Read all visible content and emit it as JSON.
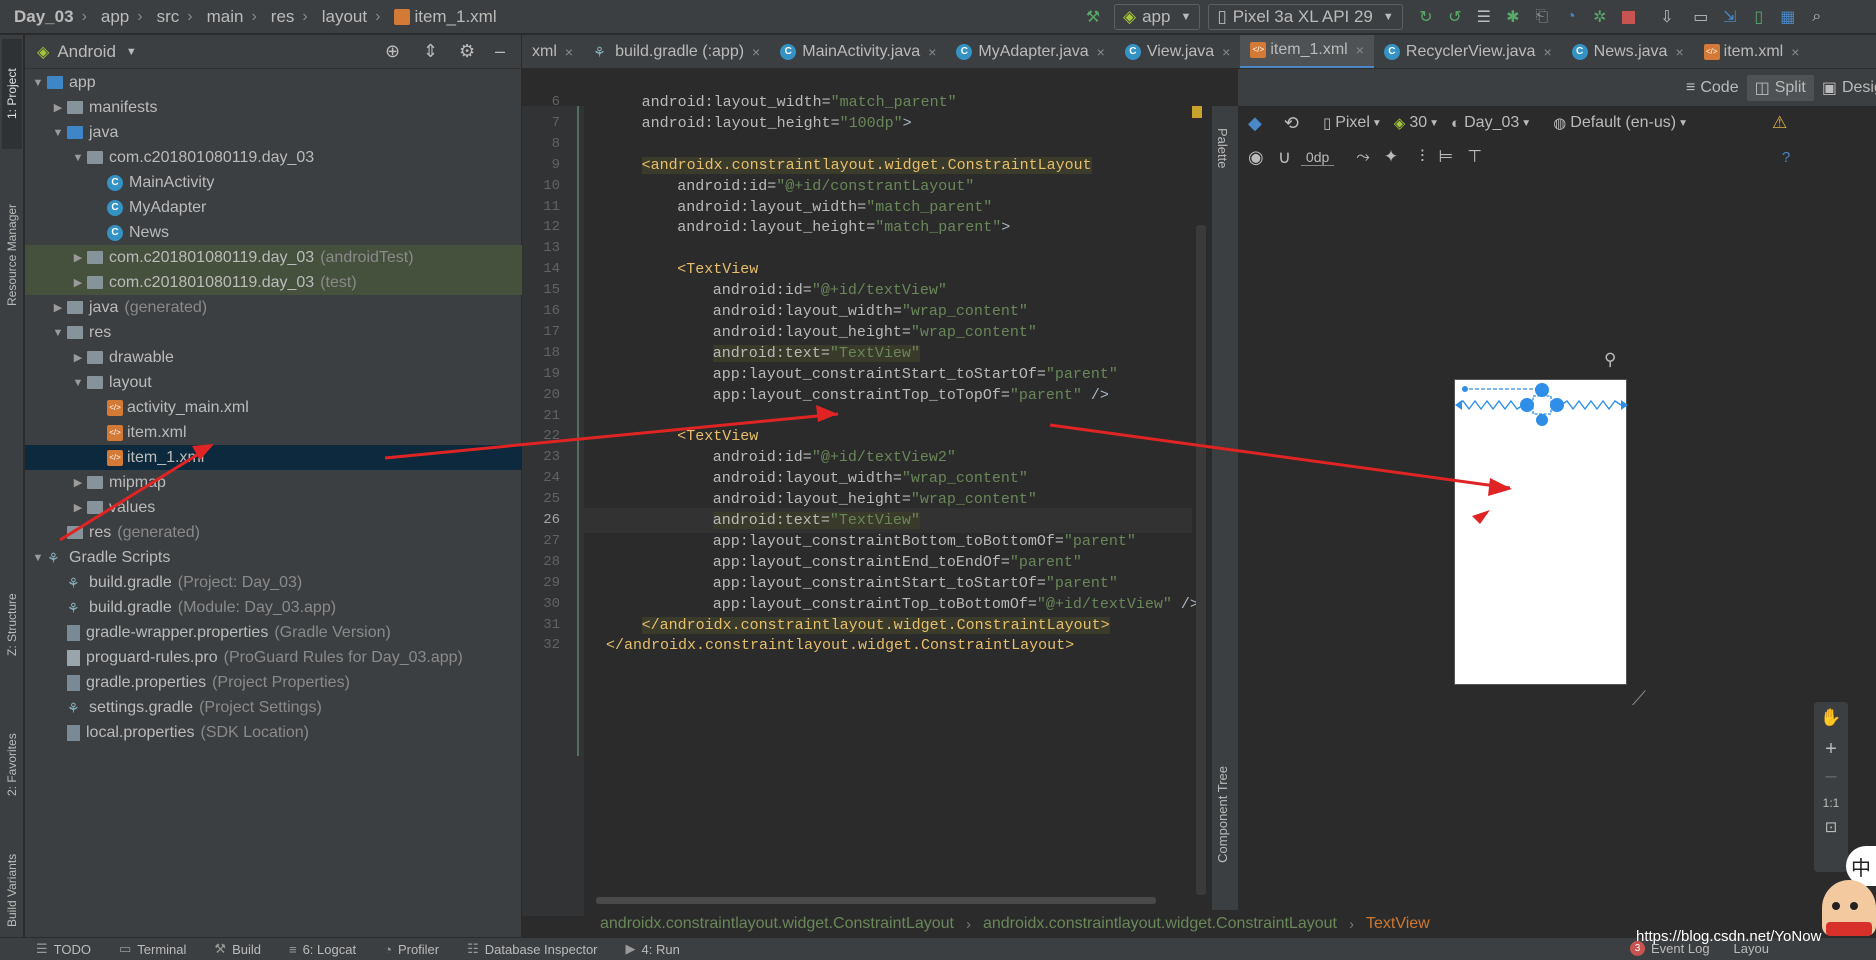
{
  "breadcrumb": [
    "Day_03",
    "app",
    "src",
    "main",
    "res",
    "layout",
    "item_1.xml"
  ],
  "toolbar": {
    "run_config": "app",
    "device": "Pixel 3a XL API 29"
  },
  "left_stripe": {
    "project_tab": "1: Project",
    "resource_manager_tab": "Resource Manager",
    "structure_tab": "Z: Structure",
    "favorites_tab": "2: Favorites",
    "build_variants_tab": "Build Variants"
  },
  "project_panel": {
    "view_mode": "Android",
    "tree": [
      {
        "label": "app",
        "depth": 0,
        "icon": "folder-module",
        "expanded": true
      },
      {
        "label": "manifests",
        "depth": 1,
        "icon": "folder",
        "expanded": false
      },
      {
        "label": "java",
        "depth": 1,
        "icon": "folder-blue",
        "expanded": true
      },
      {
        "label": "com.c201801080119.day_03",
        "depth": 2,
        "icon": "package",
        "expanded": true
      },
      {
        "label": "MainActivity",
        "depth": 3,
        "icon": "class"
      },
      {
        "label": "MyAdapter",
        "depth": 3,
        "icon": "class"
      },
      {
        "label": "News",
        "depth": 3,
        "icon": "class"
      },
      {
        "label": "com.c201801080119.day_03",
        "suffix": "(androidTest)",
        "depth": 2,
        "icon": "package",
        "expanded": false
      },
      {
        "label": "com.c201801080119.day_03",
        "suffix": "(test)",
        "depth": 2,
        "icon": "package",
        "expanded": false
      },
      {
        "label": "java",
        "suffix": "(generated)",
        "depth": 1,
        "icon": "folder-generated",
        "expanded": false
      },
      {
        "label": "res",
        "depth": 1,
        "icon": "folder-res",
        "expanded": true
      },
      {
        "label": "drawable",
        "depth": 2,
        "icon": "folder",
        "expanded": false
      },
      {
        "label": "layout",
        "depth": 2,
        "icon": "folder",
        "expanded": true
      },
      {
        "label": "activity_main.xml",
        "depth": 3,
        "icon": "xml"
      },
      {
        "label": "item.xml",
        "depth": 3,
        "icon": "xml"
      },
      {
        "label": "item_1.xml",
        "depth": 3,
        "icon": "xml",
        "selected": true
      },
      {
        "label": "mipmap",
        "depth": 2,
        "icon": "folder",
        "expanded": false
      },
      {
        "label": "values",
        "depth": 2,
        "icon": "folder",
        "expanded": false
      },
      {
        "label": "res",
        "suffix": "(generated)",
        "depth": 1,
        "icon": "folder-generated"
      },
      {
        "label": "Gradle Scripts",
        "depth": 0,
        "icon": "gradle",
        "expanded": true
      },
      {
        "label": "build.gradle",
        "suffix": "(Project: Day_03)",
        "depth": 1,
        "icon": "gradle"
      },
      {
        "label": "build.gradle",
        "suffix": "(Module: Day_03.app)",
        "depth": 1,
        "icon": "gradle"
      },
      {
        "label": "gradle-wrapper.properties",
        "suffix": "(Gradle Version)",
        "depth": 1,
        "icon": "properties"
      },
      {
        "label": "proguard-rules.pro",
        "suffix": "(ProGuard Rules for Day_03.app)",
        "depth": 1,
        "icon": "file"
      },
      {
        "label": "gradle.properties",
        "suffix": "(Project Properties)",
        "depth": 1,
        "icon": "properties"
      },
      {
        "label": "settings.gradle",
        "suffix": "(Project Settings)",
        "depth": 1,
        "icon": "gradle"
      },
      {
        "label": "local.properties",
        "suffix": "(SDK Location)",
        "depth": 1,
        "icon": "properties"
      }
    ]
  },
  "editor_tabs": [
    {
      "label": "xml",
      "icon": "xml"
    },
    {
      "label": "build.gradle (:app)",
      "icon": "gradle"
    },
    {
      "label": "MainActivity.java",
      "icon": "class"
    },
    {
      "label": "MyAdapter.java",
      "icon": "class"
    },
    {
      "label": "View.java",
      "icon": "class"
    },
    {
      "label": "item_1.xml",
      "icon": "xml",
      "active": true
    },
    {
      "label": "RecyclerView.java",
      "icon": "class"
    },
    {
      "label": "News.java",
      "icon": "class"
    },
    {
      "label": "item.xml",
      "icon": "xml"
    }
  ],
  "view_modes": {
    "code": "Code",
    "split": "Split",
    "design": "Desig"
  },
  "code_lines": [
    {
      "n": 6,
      "parts": [
        [
          "attr",
          "android:layout_width="
        ],
        [
          "val",
          "\"match_parent\""
        ]
      ],
      "indent": 4
    },
    {
      "n": 7,
      "parts": [
        [
          "attr",
          "android:layout_height="
        ],
        [
          "val",
          "\"100dp\""
        ],
        [
          "plain",
          ">"
        ]
      ],
      "indent": 4
    },
    {
      "n": 8,
      "parts": [],
      "indent": 0
    },
    {
      "n": 9,
      "parts": [
        [
          "tag",
          "<androidx.constraintlayout.widget.ConstraintLayout"
        ]
      ],
      "indent": 4,
      "tagbg": true
    },
    {
      "n": 10,
      "parts": [
        [
          "attr",
          "android:id="
        ],
        [
          "val",
          "\"@+id/constrantLayout\""
        ]
      ],
      "indent": 8
    },
    {
      "n": 11,
      "parts": [
        [
          "attr",
          "android:layout_width="
        ],
        [
          "val",
          "\"match_parent\""
        ]
      ],
      "indent": 8
    },
    {
      "n": 12,
      "parts": [
        [
          "attr",
          "android:layout_height="
        ],
        [
          "val",
          "\"match_parent\""
        ],
        [
          "plain",
          ">"
        ]
      ],
      "indent": 8
    },
    {
      "n": 13,
      "parts": [],
      "indent": 0
    },
    {
      "n": 14,
      "parts": [
        [
          "tag",
          "<TextView"
        ]
      ],
      "indent": 8
    },
    {
      "n": 15,
      "parts": [
        [
          "attr",
          "android:id="
        ],
        [
          "val",
          "\"@+id/textView\""
        ]
      ],
      "indent": 12
    },
    {
      "n": 16,
      "parts": [
        [
          "attr",
          "android:layout_width="
        ],
        [
          "val",
          "\"wrap_content\""
        ]
      ],
      "indent": 12
    },
    {
      "n": 17,
      "parts": [
        [
          "attr",
          "android:layout_height="
        ],
        [
          "val",
          "\"wrap_content\""
        ]
      ],
      "indent": 12
    },
    {
      "n": 18,
      "parts": [
        [
          "attr",
          "android:text="
        ],
        [
          "val",
          "\"TextView\""
        ]
      ],
      "indent": 12,
      "hl": true
    },
    {
      "n": 19,
      "parts": [
        [
          "attr",
          "app:layout_constraintStart_toStartOf="
        ],
        [
          "val",
          "\"parent\""
        ]
      ],
      "indent": 12
    },
    {
      "n": 20,
      "parts": [
        [
          "attr",
          "app:layout_constraintTop_toTopOf="
        ],
        [
          "val",
          "\"parent\""
        ],
        [
          "plain",
          " />"
        ]
      ],
      "indent": 12
    },
    {
      "n": 21,
      "parts": [],
      "indent": 0
    },
    {
      "n": 22,
      "parts": [
        [
          "tag",
          "<TextView"
        ]
      ],
      "indent": 8
    },
    {
      "n": 23,
      "parts": [
        [
          "attr",
          "android:id="
        ],
        [
          "val",
          "\"@+id/textView2\""
        ]
      ],
      "indent": 12
    },
    {
      "n": 24,
      "parts": [
        [
          "attr",
          "android:layout_width="
        ],
        [
          "val",
          "\"wrap_content\""
        ]
      ],
      "indent": 12
    },
    {
      "n": 25,
      "parts": [
        [
          "attr",
          "android:layout_height="
        ],
        [
          "val",
          "\"wrap_content\""
        ]
      ],
      "indent": 12
    },
    {
      "n": 26,
      "parts": [
        [
          "attr",
          "android:text="
        ],
        [
          "val",
          "\"TextView\""
        ]
      ],
      "indent": 12,
      "hl": true,
      "current": true
    },
    {
      "n": 27,
      "parts": [
        [
          "attr",
          "app:layout_constraintBottom_toBottomOf="
        ],
        [
          "val",
          "\"parent\""
        ]
      ],
      "indent": 12
    },
    {
      "n": 28,
      "parts": [
        [
          "attr",
          "app:layout_constraintEnd_toEndOf="
        ],
        [
          "val",
          "\"parent\""
        ]
      ],
      "indent": 12
    },
    {
      "n": 29,
      "parts": [
        [
          "attr",
          "app:layout_constraintStart_toStartOf="
        ],
        [
          "val",
          "\"parent\""
        ]
      ],
      "indent": 12
    },
    {
      "n": 30,
      "parts": [
        [
          "attr",
          "app:layout_constraintTop_toBottomOf="
        ],
        [
          "val",
          "\"@+id/textView\""
        ],
        [
          "plain",
          " />"
        ]
      ],
      "indent": 12
    },
    {
      "n": 31,
      "parts": [
        [
          "tag",
          "</androidx.constraintlayout.widget.ConstraintLayout>"
        ]
      ],
      "indent": 4,
      "tagbg": true
    },
    {
      "n": 32,
      "parts": [
        [
          "tag",
          "</androidx.constraintlayout.widget.ConstraintLayout>"
        ]
      ],
      "indent": 0
    }
  ],
  "design_toolbar": {
    "device": "Pixel",
    "api": "30",
    "theme": "Day_03",
    "locale": "Default (en-us)",
    "margin": "0dp"
  },
  "side_tabs": {
    "palette": "Palette",
    "component_tree": "Component Tree"
  },
  "zoom": {
    "fit": "1:1"
  },
  "bottom_breadcrumb": [
    "androidx.constraintlayout.widget.ConstraintLayout",
    "androidx.constraintlayout.widget.ConstraintLayout",
    "TextView"
  ],
  "status_tabs": [
    "TODO",
    "Terminal",
    "Build",
    "6: Logcat",
    "Profiler",
    "Database Inspector",
    "4: Run"
  ],
  "status_right": {
    "event_log": "Event Log",
    "layout": "Layou",
    "event_count": "3"
  },
  "watermark": "https://blog.csdn.net/YoNow",
  "ime_char": "中",
  "colors": {
    "accent": "#4a88c7",
    "arrow": "#e02424",
    "selection": "#0d293e",
    "blueprint": "#2f8fe8"
  }
}
